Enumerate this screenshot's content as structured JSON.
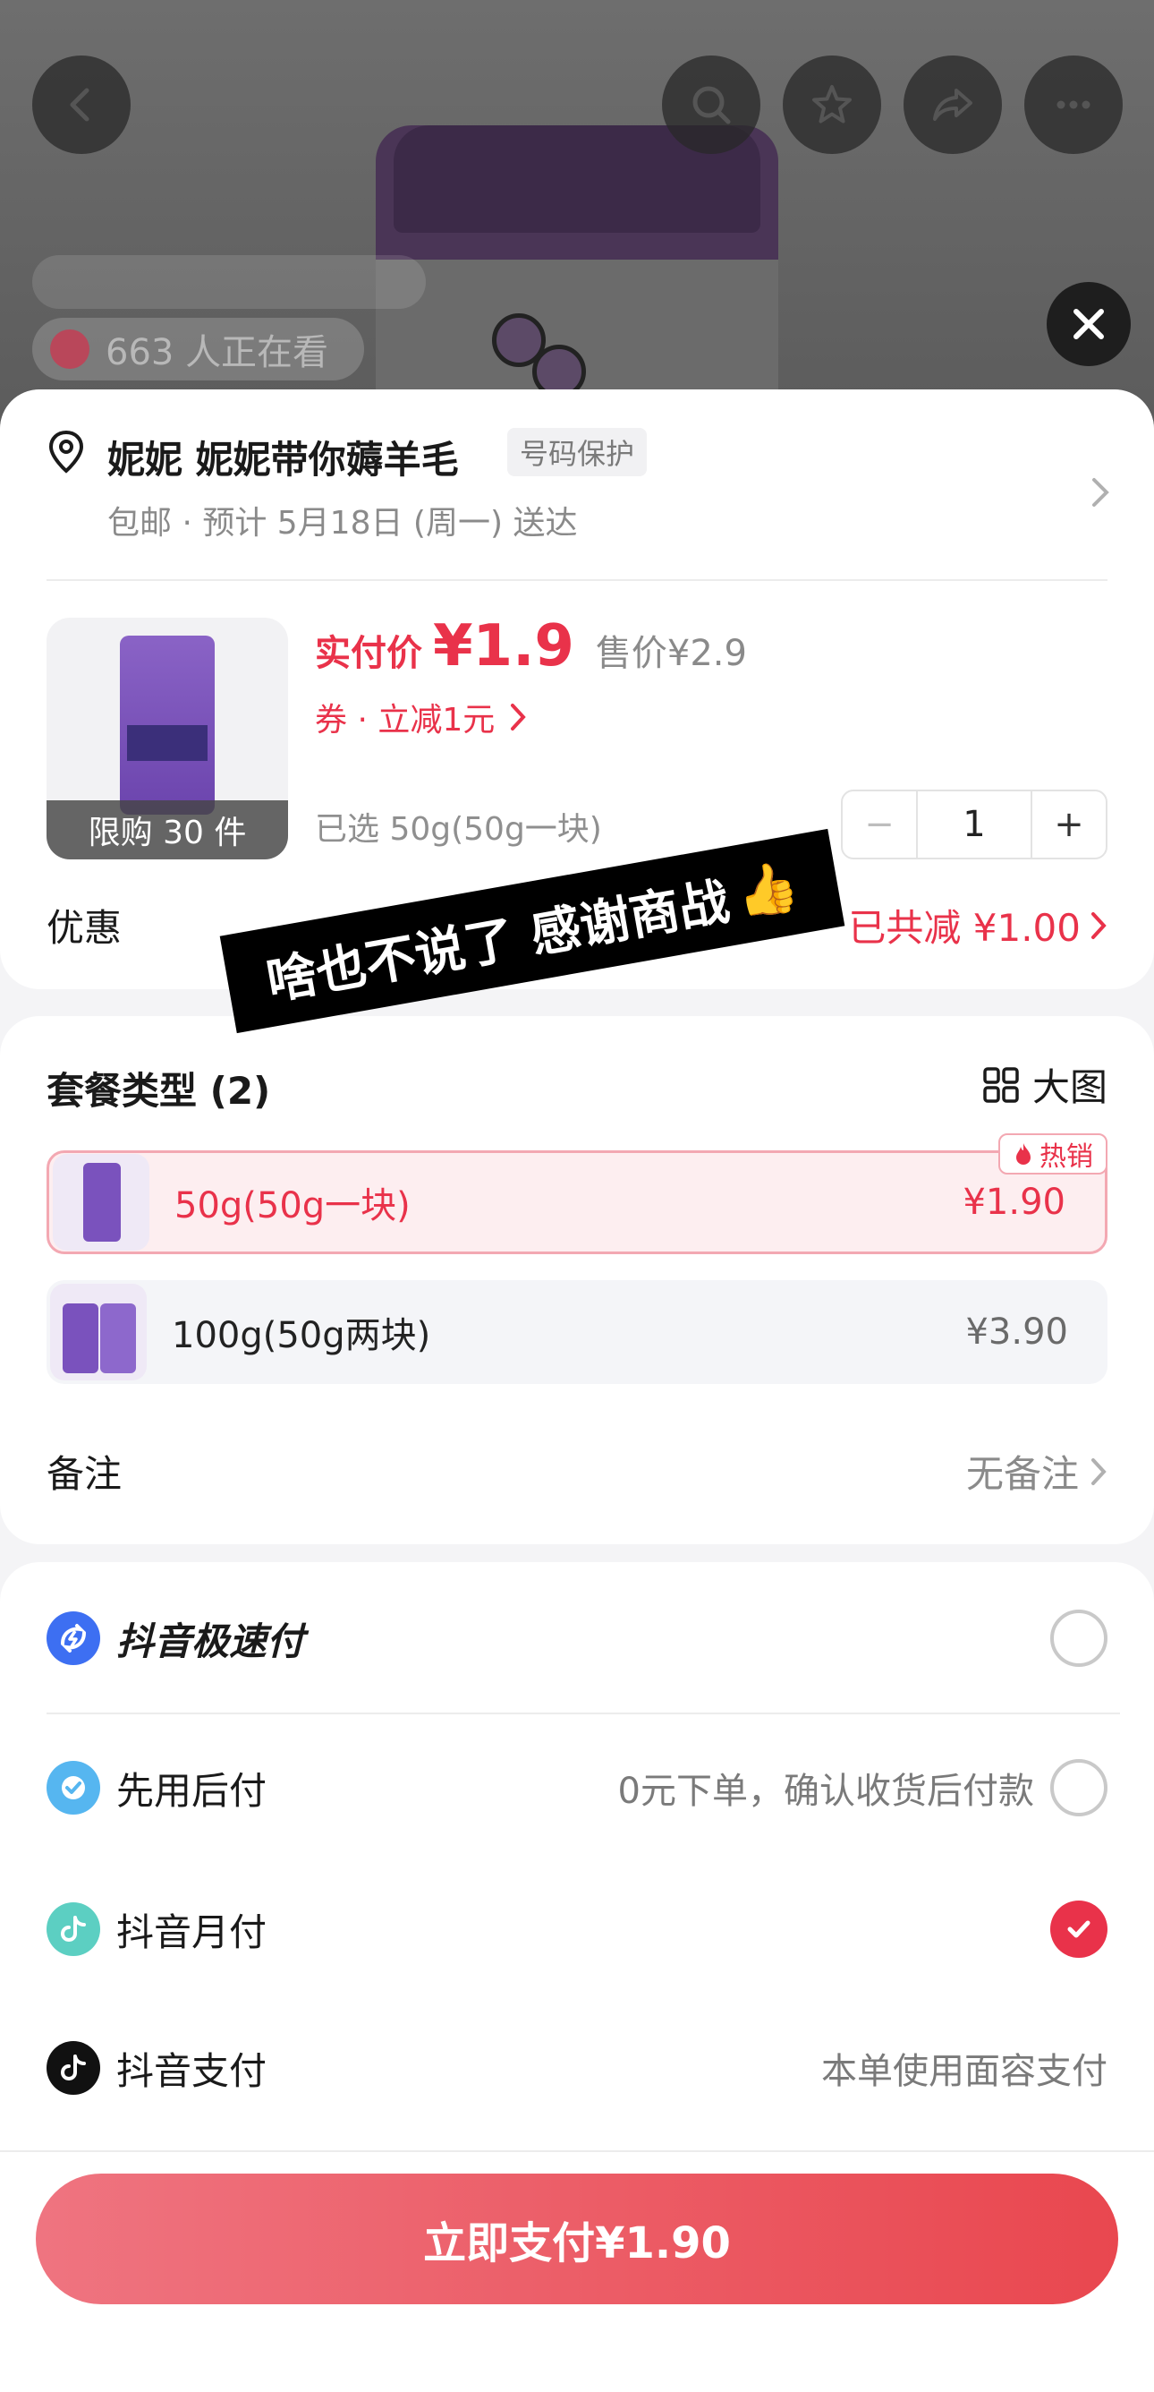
{
  "background": {
    "viewer_count_text": "663 人正在看"
  },
  "address": {
    "name": "妮妮  妮妮带你薅羊毛",
    "badge": "号码保护",
    "delivery": "包邮 · 预计 5月18日 (周一) 送达"
  },
  "product": {
    "limit_badge": "限购 30 件",
    "price_label": "实付价",
    "price_value": "¥1.9",
    "original_price": "售价¥2.9",
    "coupon": "券 · 立减1元",
    "selected_spec": "已选 50g(50g一块)",
    "quantity": "1",
    "minus": "−",
    "plus": "+"
  },
  "promotion": {
    "label": "优惠",
    "value": "已共减 ¥1.00"
  },
  "sticker": {
    "text": "啥也不说了 感谢商战",
    "emoji": "👍"
  },
  "package": {
    "title": "套餐类型 (2)",
    "view_label": "大图",
    "hot_badge": "热销",
    "options": [
      {
        "label": "50g(50g一块)",
        "price": "¥1.90",
        "selected": true
      },
      {
        "label": "100g(50g两块)",
        "price": "¥3.90",
        "selected": false
      }
    ]
  },
  "note": {
    "label": "备注",
    "value": "无备注"
  },
  "payment": {
    "methods": [
      {
        "label": "抖音极速付",
        "hint": "",
        "selected": false
      },
      {
        "label": "先用后付",
        "hint": "0元下单，确认收货后付款",
        "selected": false
      },
      {
        "label": "抖音月付",
        "hint": "",
        "selected": true
      },
      {
        "label": "抖音支付",
        "hint": "本单使用面容支付",
        "selected": false
      }
    ]
  },
  "submit": {
    "label": "立即支付¥1.90"
  },
  "colors": {
    "accent": "#e9324a",
    "submit_start": "#ef7480",
    "submit_end": "#e9474f"
  }
}
